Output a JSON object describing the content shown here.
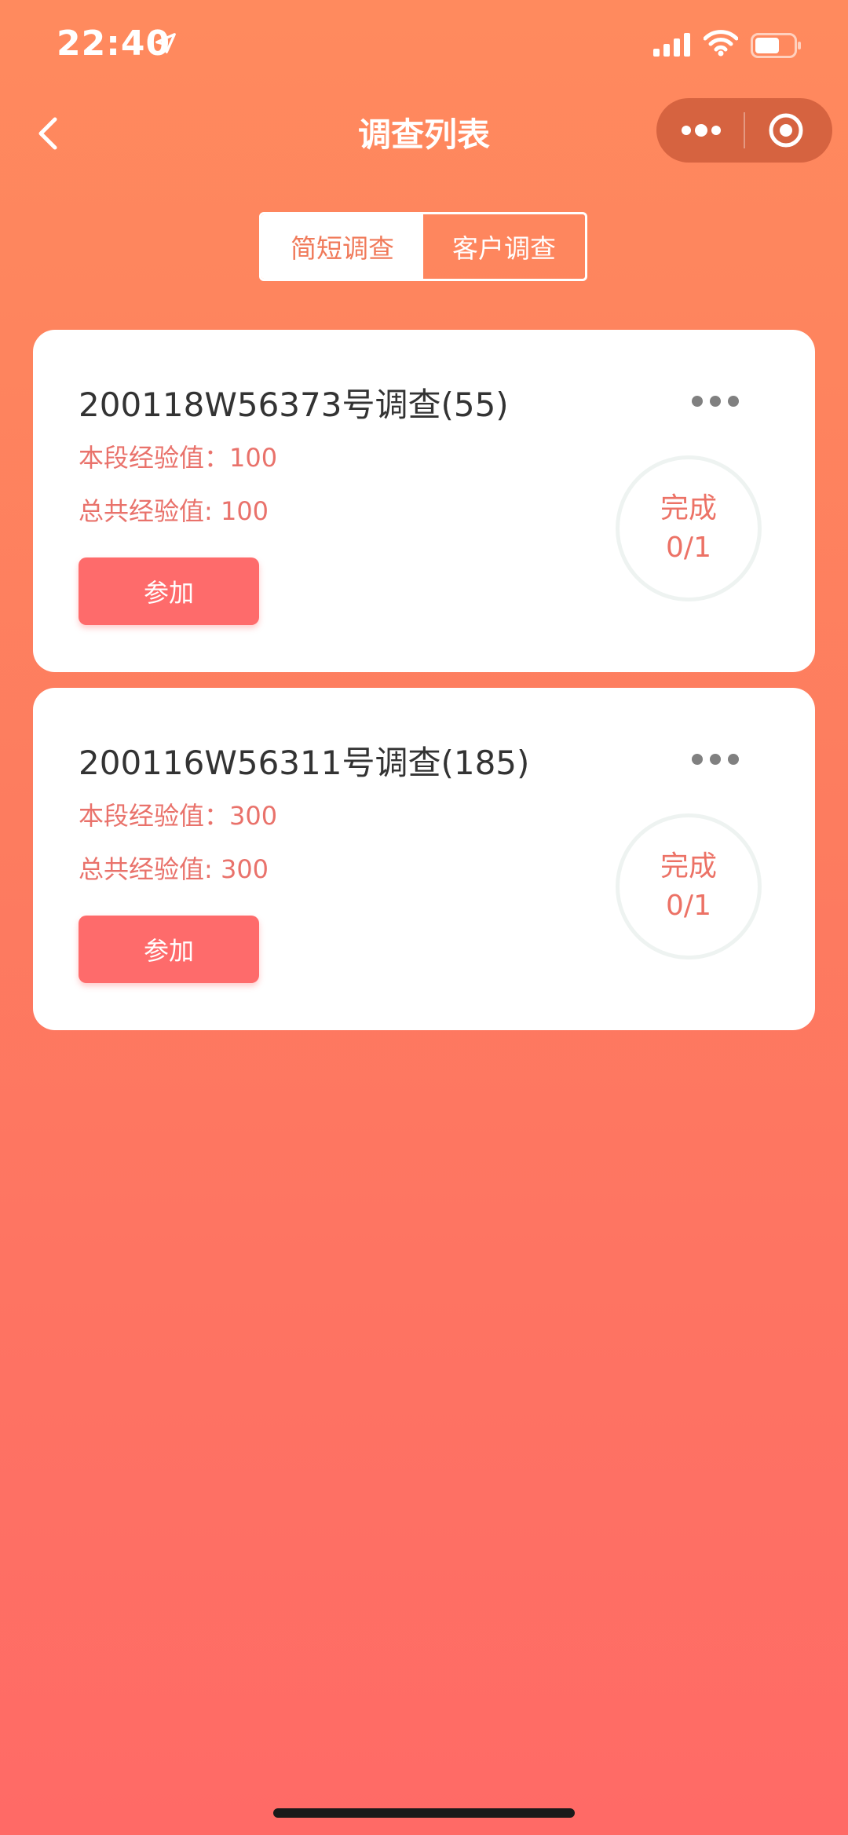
{
  "status_bar": {
    "time": "22:40"
  },
  "nav": {
    "title": "调查列表"
  },
  "tabs": [
    {
      "label": "简短调查",
      "active": true
    },
    {
      "label": "客户调查",
      "active": false
    }
  ],
  "surveys": [
    {
      "title": "200118W56373号调查(55)",
      "segment_exp": "本段经验值：100",
      "total_exp": "总共经验值: 100",
      "join_label": "参加",
      "status_label": "完成",
      "progress": "0/1"
    },
    {
      "title": "200116W56311号调查(185)",
      "segment_exp": "本段经验值：300",
      "total_exp": "总共经验值: 300",
      "join_label": "参加",
      "status_label": "完成",
      "progress": "0/1"
    }
  ],
  "colors": {
    "accent": "#fe6b6b",
    "text_accent": "#e9726b",
    "background_top": "#ff8a5e",
    "background_bottom": "#ff6a66"
  },
  "icons": {
    "back": "chevron-left-icon",
    "capsule_more": "more-dots-icon",
    "capsule_close": "target-icon",
    "card_more": "ellipsis-icon"
  }
}
